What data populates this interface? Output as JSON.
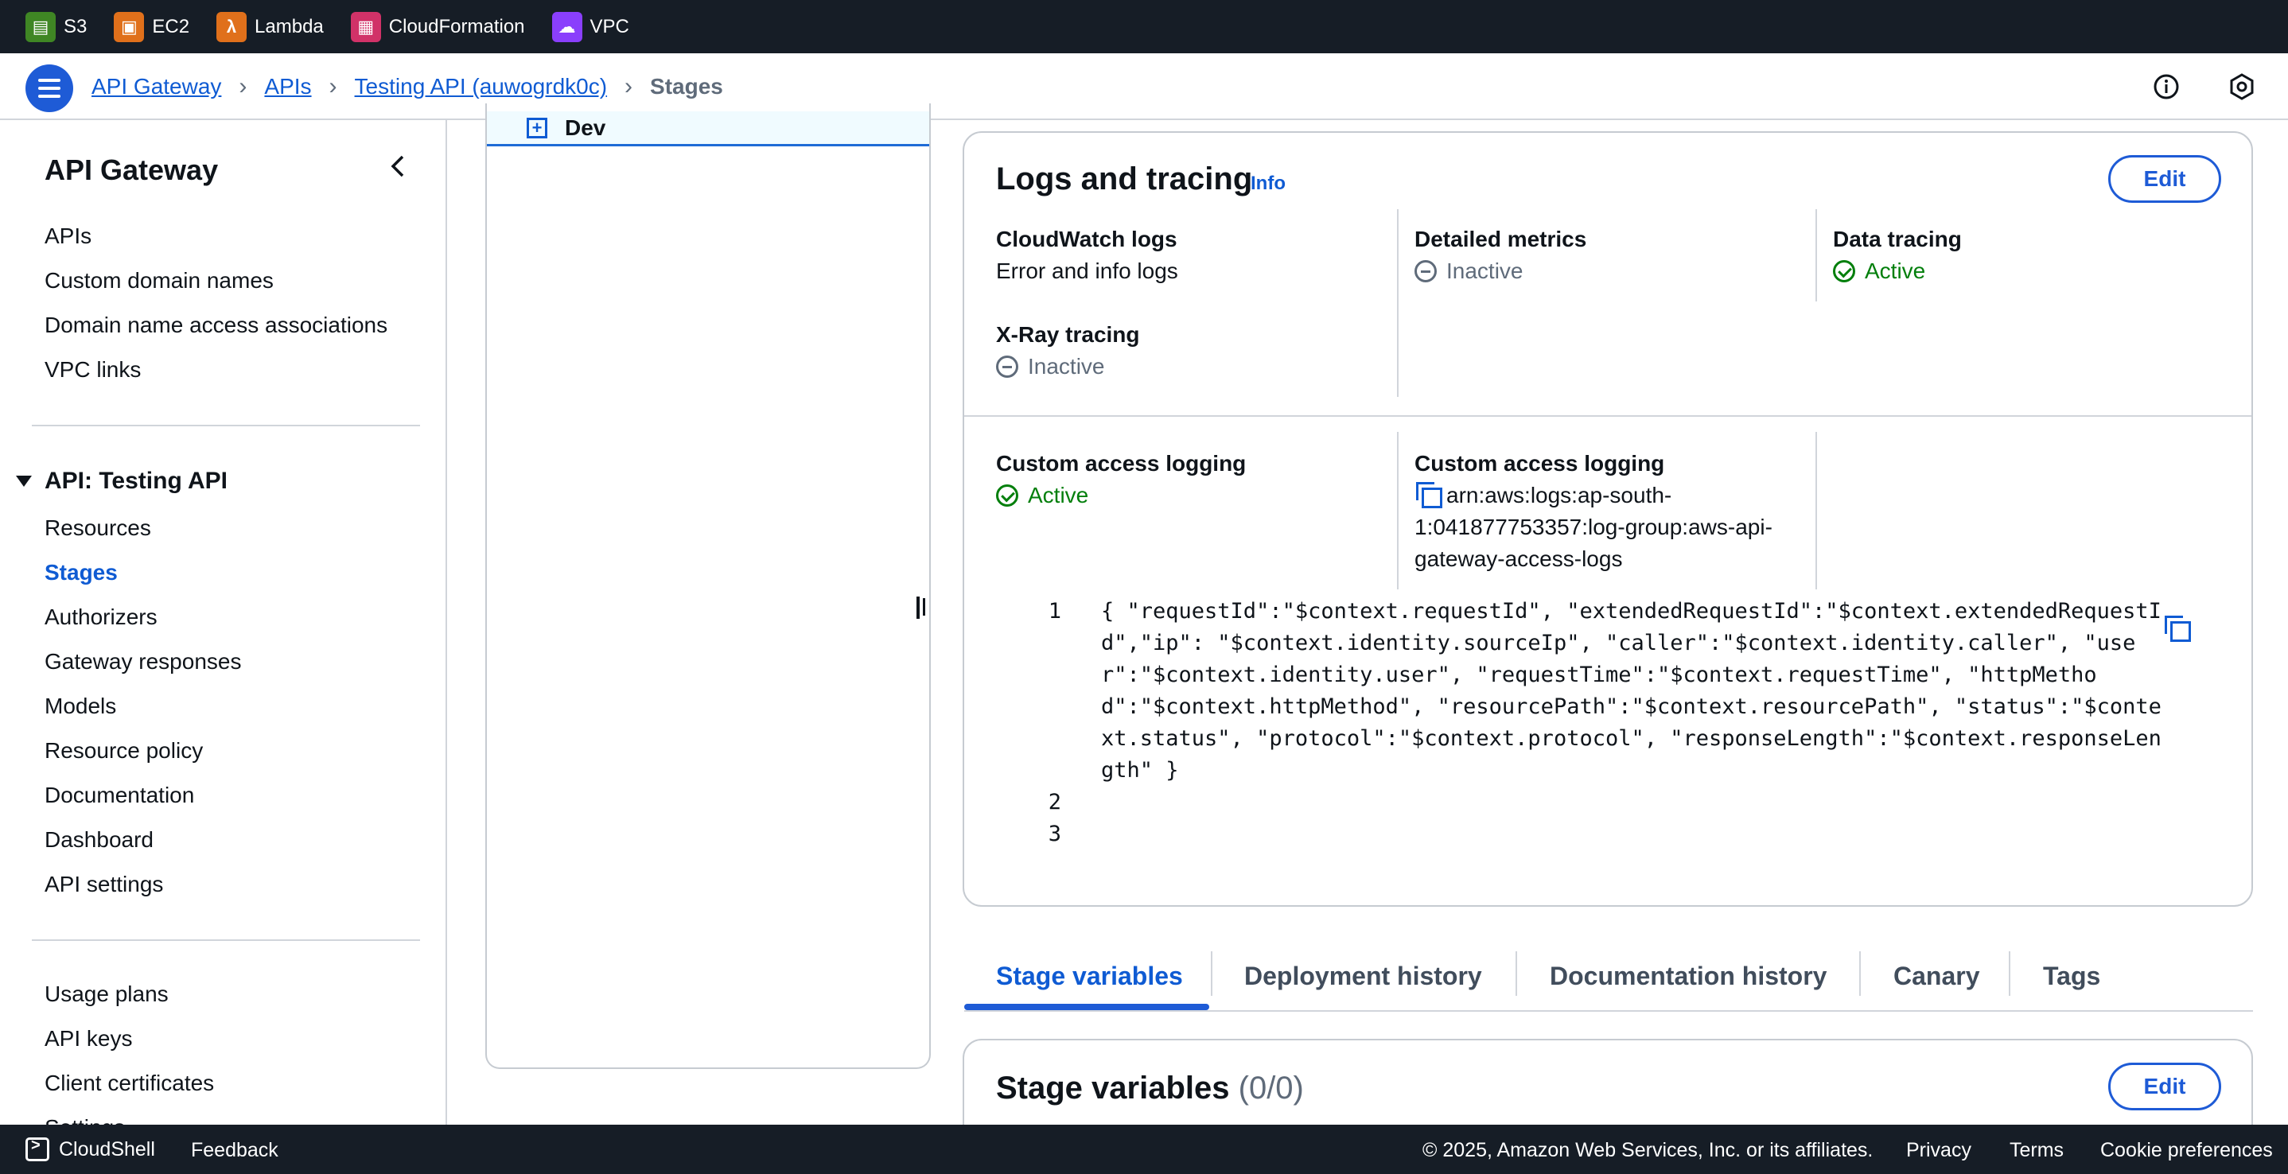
{
  "services": [
    {
      "label": "S3",
      "icon": "s3-icon",
      "color": "#3f8624"
    },
    {
      "label": "EC2",
      "icon": "ec2-icon",
      "color": "#e0701b"
    },
    {
      "label": "Lambda",
      "icon": "lambda-icon",
      "color": "#e0701b"
    },
    {
      "label": "CloudFormation",
      "icon": "cloudformation-icon",
      "color": "#d13268"
    },
    {
      "label": "VPC",
      "icon": "vpc-icon",
      "color": "#8a3ffc"
    }
  ],
  "breadcrumbs": {
    "items": [
      "API Gateway",
      "APIs",
      "Testing API (auwogrdk0c)"
    ],
    "current": "Stages"
  },
  "sidenav": {
    "title": "API Gateway",
    "group1": [
      "APIs",
      "Custom domain names",
      "Domain name access associations",
      "VPC links"
    ],
    "section": "API: Testing API",
    "group2": [
      "Resources",
      "Stages",
      "Authorizers",
      "Gateway responses",
      "Models",
      "Resource policy",
      "Documentation",
      "Dashboard",
      "API settings"
    ],
    "active": "Stages",
    "group3": [
      "Usage plans",
      "API keys",
      "Client certificates",
      "Settings"
    ]
  },
  "tree": {
    "item": "Dev"
  },
  "logs": {
    "title": "Logs and tracing",
    "info": "Info",
    "edit": "Edit",
    "cloudwatch_label": "CloudWatch logs",
    "cloudwatch_value": "Error and info logs",
    "metrics_label": "Detailed metrics",
    "metrics_value": "Inactive",
    "tracing_label": "Data tracing",
    "tracing_value": "Active",
    "xray_label": "X-Ray tracing",
    "xray_value": "Inactive",
    "access_label": "Custom access logging",
    "access_value": "Active",
    "access_arn_label": "Custom access logging",
    "access_arn": "arn:aws:logs:ap-south-1:041877753357:log-group:aws-api-gateway-access-logs",
    "code_lines": [
      {
        "n": "1",
        "text": "{ \"requestId\":\"$context.requestId\", \"extendedRequestId\":\"$context.extendedRequestId\",\"ip\": \"$context.identity.sourceIp\", \"caller\":\"$context.identity.caller\", \"user\":\"$context.identity.user\", \"requestTime\":\"$context.requestTime\", \"httpMethod\":\"$context.httpMethod\", \"resourcePath\":\"$context.resourcePath\", \"status\":\"$context.status\", \"protocol\":\"$context.protocol\", \"responseLength\":\"$context.responseLength\" }"
      },
      {
        "n": "2",
        "text": ""
      },
      {
        "n": "3",
        "text": ""
      }
    ]
  },
  "tabs": [
    "Stage variables",
    "Deployment history",
    "Documentation history",
    "Canary",
    "Tags"
  ],
  "stage_variables": {
    "title": "Stage variables",
    "count": "(0/0)",
    "edit": "Edit"
  },
  "footer": {
    "cloudshell": "CloudShell",
    "feedback": "Feedback",
    "copyright": "© 2025, Amazon Web Services, Inc. or its affiliates.",
    "privacy": "Privacy",
    "terms": "Terms",
    "cookies": "Cookie preferences"
  }
}
